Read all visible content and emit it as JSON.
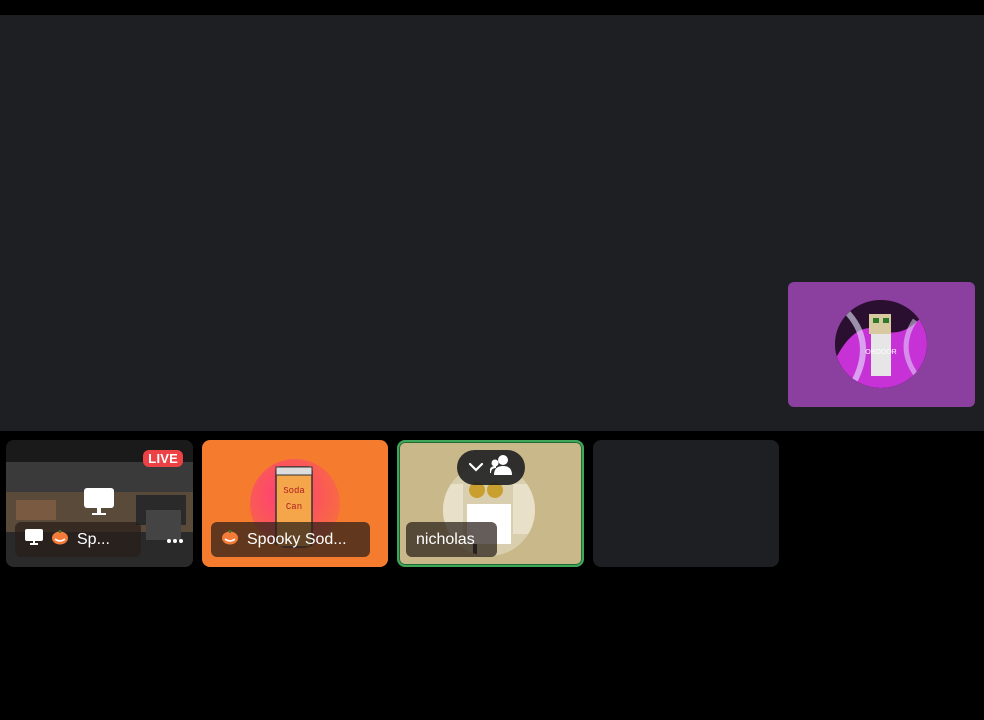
{
  "tiles": [
    {
      "badge": "LIVE",
      "label": "Sp...",
      "icon": "screen-share-icon",
      "emoji": "pumpkin"
    },
    {
      "label": "Spooky Sod...",
      "emoji": "pumpkin",
      "art_text_top": "Soda",
      "art_text_bottom": "Can"
    },
    {
      "label": "nicholas",
      "speaking": true
    },
    {
      "label": ""
    }
  ],
  "pip": {
    "avatar_text": "OBOOOR"
  },
  "colors": {
    "stage": "#1e1f22",
    "pip_bg": "#8b3f9e",
    "live": "#ed4245",
    "speaking_ring": "#3fa65a",
    "soda_bg": "#f57c2e"
  }
}
